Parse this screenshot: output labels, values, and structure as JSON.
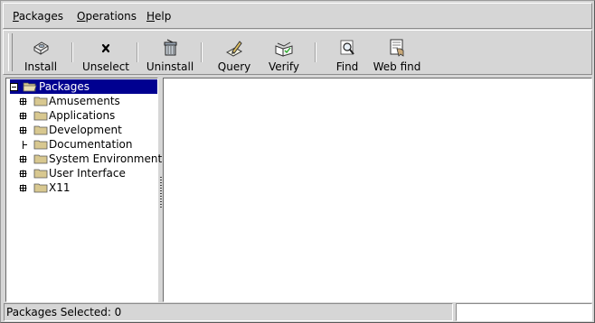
{
  "menubar": {
    "items": [
      {
        "accel": "P",
        "rest": "ackages"
      },
      {
        "accel": "O",
        "rest": "perations"
      },
      {
        "accel": "H",
        "rest": "elp"
      }
    ]
  },
  "toolbar": {
    "buttons": [
      {
        "label": "Install",
        "icon": "install-disk-icon"
      },
      {
        "label": "Unselect",
        "icon": "x-icon"
      },
      {
        "label": "Uninstall",
        "icon": "uninstall-trash-icon"
      },
      {
        "label": "Query",
        "icon": "query-pencil-icon"
      },
      {
        "label": "Verify",
        "icon": "verify-book-icon"
      },
      {
        "label": "Find",
        "icon": "find-magnifier-icon"
      },
      {
        "label": "Web find",
        "icon": "web-find-icon"
      }
    ]
  },
  "tree": {
    "root": "Packages",
    "items": [
      {
        "label": "Amusements",
        "expandable": true
      },
      {
        "label": "Applications",
        "expandable": true
      },
      {
        "label": "Development",
        "expandable": true
      },
      {
        "label": "Documentation",
        "expandable": false
      },
      {
        "label": "System Environment",
        "expandable": true
      },
      {
        "label": "User Interface",
        "expandable": true
      },
      {
        "label": "X11",
        "expandable": true
      }
    ]
  },
  "status": {
    "text": "Packages Selected: 0"
  },
  "colors": {
    "selection": "#000090",
    "folder": "#d8c890"
  }
}
